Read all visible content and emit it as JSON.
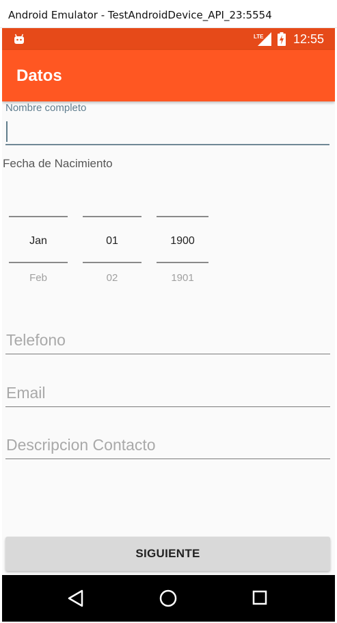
{
  "window": {
    "title": "Android Emulator - TestAndroidDevice_API_23:5554"
  },
  "status_bar": {
    "time": "12:55",
    "network": "LTE",
    "bg_color": "#e64a19"
  },
  "app_bar": {
    "title": "Datos",
    "color": "#ff5722"
  },
  "form": {
    "name_label": "Nombre completo",
    "name_value": "",
    "dob_label": "Fecha de Nacimiento",
    "date_picker": {
      "month": {
        "selected": "Jan",
        "next": "Feb"
      },
      "day": {
        "selected": "01",
        "next": "02"
      },
      "year": {
        "selected": "1900",
        "next": "1901"
      }
    },
    "phone_placeholder": "Telefono",
    "email_placeholder": "Email",
    "description_placeholder": "Descripcion Contacto",
    "next_button": "SIGUIENTE"
  },
  "nav_bar": {
    "back": "back-icon",
    "home": "home-icon",
    "recents": "recents-icon"
  }
}
